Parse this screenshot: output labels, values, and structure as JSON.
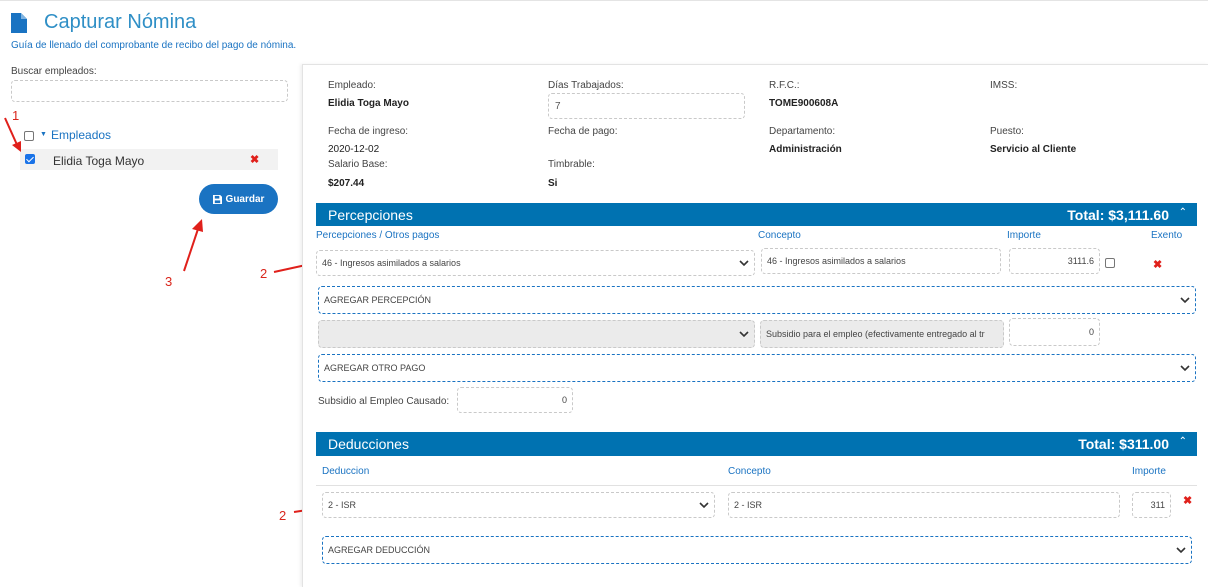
{
  "header": {
    "title": "Capturar Nómina",
    "subtitle": "Guía de llenado del comprobante de recibo del pago de nómina."
  },
  "sidebar": {
    "search_label": "Buscar empleados:",
    "search_value": "",
    "tree_label": "Empleados",
    "employees": [
      {
        "name": "Elidia Toga Mayo",
        "checked": true
      }
    ],
    "save_label": "Guardar"
  },
  "annotations": [
    "1",
    "2",
    "3",
    "2",
    "2"
  ],
  "employee_info": {
    "empleado_label": "Empleado:",
    "empleado_value": "Elidia Toga Mayo",
    "dias_label": "Días Trabajados:",
    "dias_value": "7",
    "rfc_label": "R.F.C.:",
    "rfc_value": "TOME900608A",
    "imss_label": "IMSS:",
    "fecha_ingreso_label": "Fecha de ingreso:",
    "fecha_ingreso_value": "2020-12-02",
    "fecha_pago_label": "Fecha de pago:",
    "departamento_label": "Departamento:",
    "departamento_value": "Administración",
    "puesto_label": "Puesto:",
    "puesto_value": "Servicio al Cliente",
    "salario_label": "Salario Base:",
    "salario_value": "$207.44",
    "timbrable_label": "Timbrable:",
    "timbrable_value": "Si"
  },
  "percepciones": {
    "title": "Percepciones",
    "total": "Total: $3,111.60",
    "col_tipo": "Percepciones / Otros pagos",
    "col_concepto": "Concepto",
    "col_importe": "Importe",
    "col_exento": "Exento",
    "row": {
      "tipo": "46 - Ingresos asimilados a salarios",
      "concepto": "46 - Ingresos asimilados a salarios",
      "importe": "3111.6"
    },
    "add_percepcion": "AGREGAR PERCEPCIÓN",
    "otro_pago": {
      "tipo": "",
      "concepto": "Subsidio para el empleo (efectivamente entregado al tr",
      "importe": "0"
    },
    "add_otro_pago": "AGREGAR OTRO PAGO",
    "subsidio_label": "Subsidio al Empleo Causado:",
    "subsidio_value": "0"
  },
  "deducciones": {
    "title": "Deducciones",
    "total": "Total: $311.00",
    "col_tipo": "Deduccion",
    "col_concepto": "Concepto",
    "col_importe": "Importe",
    "row": {
      "tipo": "2 - ISR",
      "concepto": "2 - ISR",
      "importe": "311"
    },
    "add_deduccion": "AGREGAR DEDUCCIÓN"
  },
  "colors": {
    "accent": "#0072b1",
    "link": "#1a73c2",
    "delete": "#e0201b",
    "annotation": "#d9261c"
  }
}
